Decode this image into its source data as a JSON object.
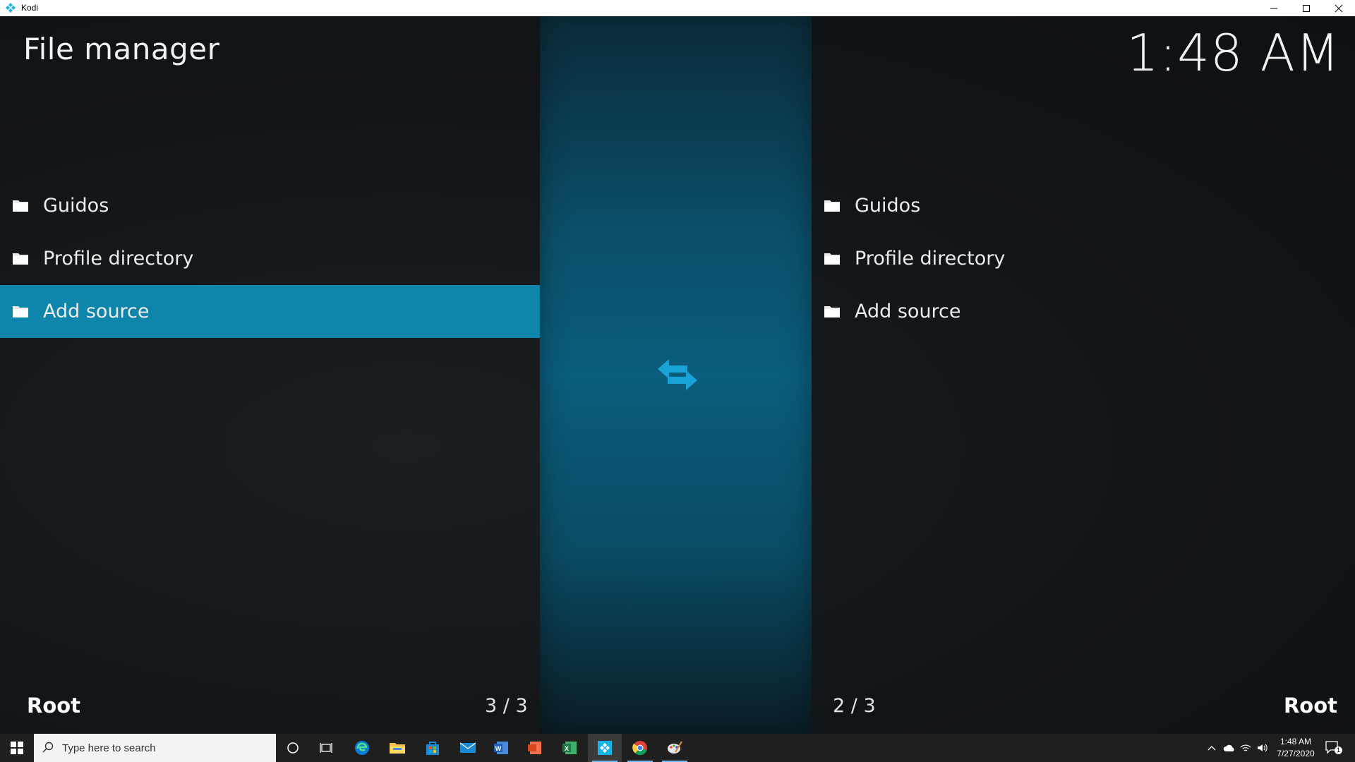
{
  "window": {
    "title": "Kodi"
  },
  "header": {
    "title": "File manager",
    "clock": "1:48 AM"
  },
  "left_pane": {
    "items": [
      {
        "label": "Guidos",
        "selected": false
      },
      {
        "label": "Profile directory",
        "selected": false
      },
      {
        "label": "Add source",
        "selected": true
      }
    ],
    "path_label": "Root",
    "count": "3 / 3"
  },
  "right_pane": {
    "items": [
      {
        "label": "Guidos"
      },
      {
        "label": "Profile directory"
      },
      {
        "label": "Add source"
      }
    ],
    "path_label": "Root",
    "count": "2 / 3"
  },
  "taskbar": {
    "search_placeholder": "Type here to search",
    "time": "1:48 AM",
    "date": "7/27/2020",
    "notification_count": "1",
    "apps": [
      "cortana-icon",
      "task-view-icon",
      "edge-icon",
      "file-explorer-icon",
      "store-icon",
      "mail-icon",
      "word-icon",
      "pdf-icon",
      "excel-icon",
      "kodi-taskbar-icon",
      "chrome-icon",
      "paint-icon"
    ]
  },
  "colors": {
    "selection": "#0e85aa",
    "accent_icon": "#1aa3d6",
    "background": "#121518"
  }
}
